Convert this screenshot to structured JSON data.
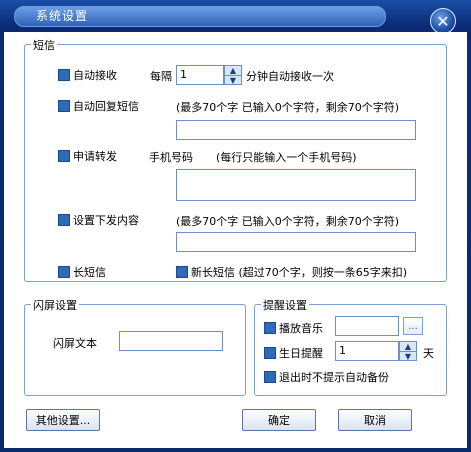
{
  "window": {
    "title": "系统设置"
  },
  "sms": {
    "group_title": "短信",
    "auto_receive_label": "自动接收",
    "every_label": "每隔",
    "interval_value": "1",
    "interval_unit": "分钟自动接收一次",
    "auto_reply_label": "自动回复短信",
    "reply_hint": "(最多70个字 已输入0个字符，剩余70个字符)",
    "forward_label": "申请转发",
    "phone_label": "手机号码",
    "phone_hint": "(每行只能输入一个手机号码)",
    "send_content_label": "设置下发内容",
    "send_hint": "(最多70个字 已输入0个字符，剩余70个字符)",
    "long_sms_label": "长短信",
    "new_long_sms_label": "新长短信 (超过70个字，则按一条65字来扣)"
  },
  "flash": {
    "group_title": "闪屏设置",
    "text_label": "闪屏文本"
  },
  "reminder": {
    "group_title": "提醒设置",
    "music_label": "播放音乐",
    "browse_label": "...",
    "birthday_label": "生日提醒",
    "days_value": "1",
    "days_unit": "天",
    "exit_backup_label": "退出时不提示自动备份"
  },
  "buttons": {
    "other": "其他设置...",
    "ok": "确定",
    "cancel": "取消"
  }
}
